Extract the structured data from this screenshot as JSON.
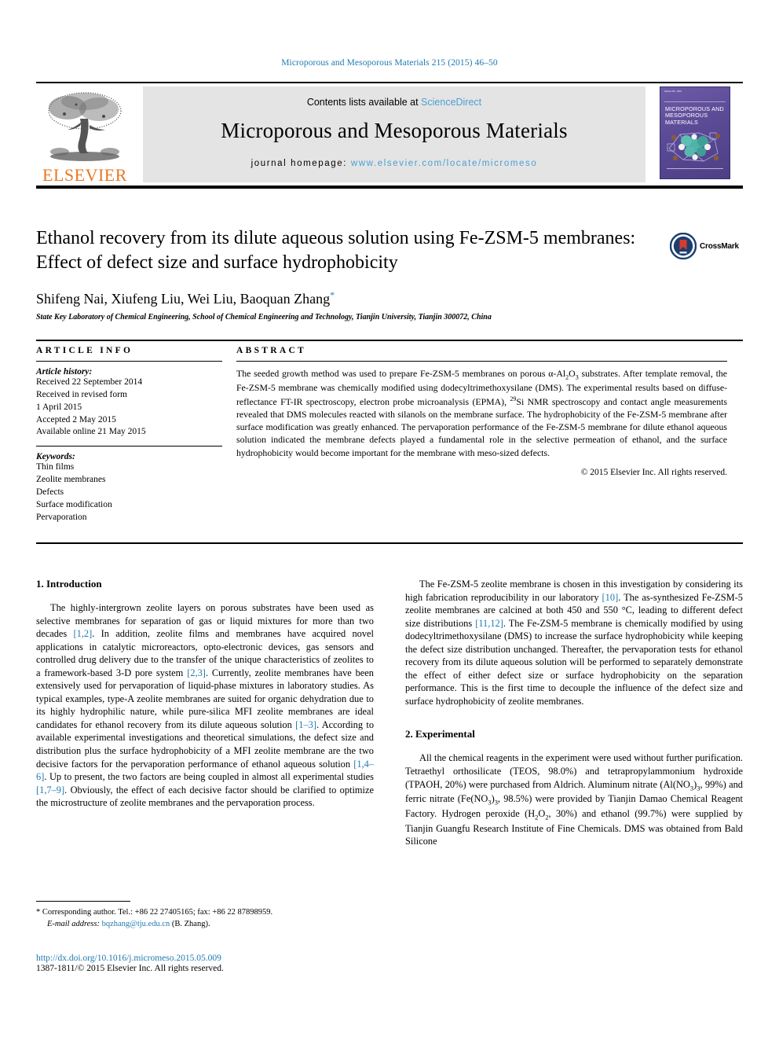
{
  "running_head": "Microporous and Mesoporous Materials 215 (2015) 46–50",
  "masthead": {
    "contents_prefix": "Contents lists available at ",
    "sciencedirect": "ScienceDirect",
    "journal_title": "Microporous and Mesoporous Materials",
    "homepage_prefix": "journal homepage: ",
    "homepage_url": "www.elsevier.com/locate/micromeso",
    "publisher_name": "ELSEVIER",
    "cover_title": "MICROPOROUS AND MESOPOROUS MATERIALS",
    "cover_topbar": "Volume 215 · 2015",
    "accent_blue": "#4a9fd4",
    "elsevier_orange": "#e87722",
    "cover_purple": "#5b4a96"
  },
  "article": {
    "title": "Ethanol recovery from its dilute aqueous solution using Fe-ZSM-5 membranes: Effect of defect size and surface hydrophobicity",
    "authors": "Shifeng Nai, Xiufeng Liu, Wei Liu, Baoquan Zhang",
    "corresponding_marker": "*",
    "affiliation": "State Key Laboratory of Chemical Engineering, School of Chemical Engineering and Technology, Tianjin University, Tianjin 300072, China",
    "crossmark_label": "CrossMark"
  },
  "article_info": {
    "heading": "ARTICLE INFO",
    "history_label": "Article history:",
    "history_lines": [
      "Received 22 September 2014",
      "Received in revised form",
      "1 April 2015",
      "Accepted 2 May 2015",
      "Available online 21 May 2015"
    ],
    "keywords_label": "Keywords:",
    "keywords": [
      "Thin films",
      "Zeolite membranes",
      "Defects",
      "Surface modification",
      "Pervaporation"
    ]
  },
  "abstract": {
    "heading": "ABSTRACT",
    "paragraph_part1": "The seeded growth method was used to prepare Fe-ZSM-5 membranes on porous α-Al",
    "paragraph_part2": "O",
    "paragraph_part3": " substrates. After template removal, the Fe-ZSM-5 membrane was chemically modified using dodecyltrimethoxysilane (DMS). The experimental results based on diffuse-reflectance FT-IR spectroscopy, electron probe microanalysis (EPMA), ",
    "si_superscript": "29",
    "paragraph_part4": "Si NMR spectroscopy and contact angle measurements revealed that DMS molecules reacted with silanols on the membrane surface. The hydrophobicity of the Fe-ZSM-5 membrane after surface modification was greatly enhanced. The pervaporation performance of the Fe-ZSM-5 membrane for dilute ethanol aqueous solution indicated the membrane defects played a fundamental role in the selective permeation of ethanol, and the surface hydrophobicity would become important for the membrane with meso-sized defects.",
    "copyright": "© 2015 Elsevier Inc. All rights reserved."
  },
  "sections": {
    "introduction_heading": "1. Introduction",
    "experimental_heading": "2. Experimental",
    "intro_p1_a": "The highly-intergrown zeolite layers on porous substrates have been used as selective membranes for separation of gas or liquid mixtures for more than two decades ",
    "intro_p1_ref1": "[1,2]",
    "intro_p1_b": ". In addition, zeolite films and membranes have acquired novel applications in catalytic microreactors, opto-electronic devices, gas sensors and controlled drug delivery due to the transfer of the unique characteristics of zeolites to a framework-based 3-D pore system ",
    "intro_p1_ref2": "[2,3]",
    "intro_p1_c": ". Currently, zeolite membranes have been extensively used for pervaporation of liquid-phase mixtures in laboratory studies. As typical examples, type-A zeolite membranes are suited for organic dehydration due to its highly hydrophilic nature, while pure-silica MFI zeolite membranes are ideal candidates for ethanol recovery from its dilute aqueous solution ",
    "intro_p1_ref3": "[1–3]",
    "intro_p1_d": ". According to available experimental investigations and theoretical simulations, the defect size and distribution plus the surface hydrophobicity of a MFI zeolite membrane are the two decisive factors for the pervaporation performance of ethanol aqueous solution ",
    "intro_p1_ref4": "[1,4–6]",
    "intro_p1_e": ". Up to present, the two factors are being coupled in almost all experimental studies ",
    "intro_p1_ref5": "[1,7–9]",
    "intro_p1_f": ". Obviously, the effect of each decisive factor should be clarified to optimize the microstructure of zeolite membranes and the pervaporation process.",
    "intro_p2_a": "The Fe-ZSM-5 zeolite membrane is chosen in this investigation by considering its high fabrication reproducibility in our laboratory ",
    "intro_p2_ref1": "[10]",
    "intro_p2_b": ". The as-synthesized Fe-ZSM-5 zeolite membranes are calcined at both 450 and 550 °C, leading to different defect size distributions ",
    "intro_p2_ref2": "[11,12]",
    "intro_p2_c": ". The Fe-ZSM-5 membrane is chemically modified by using dodecyltrimethoxysilane (DMS) to increase the surface hydrophobicity while keeping the defect size distribution unchanged. Thereafter, the pervaporation tests for ethanol recovery from its dilute aqueous solution will be performed to separately demonstrate the effect of either defect size or surface hydrophobicity on the separation performance. This is the first time to decouple the influence of the defect size and surface hydrophobicity of zeolite membranes.",
    "exp_p1_a": "All the chemical reagents in the experiment were used without further purification. Tetraethyl orthosilicate (TEOS, 98.0%) and tetrapropylammonium hydroxide (TPAOH, 20%) were purchased from Aldrich. Aluminum nitrate (Al(NO",
    "exp_sub1": "3",
    "exp_p1_b": ")",
    "exp_sub2": "3",
    "exp_p1_c": ", 99%) and ferric nitrate (Fe(NO",
    "exp_sub3": "3",
    "exp_p1_d": ")",
    "exp_sub4": "3",
    "exp_p1_e": ", 98.5%) were provided by Tianjin Damao Chemical Reagent Factory. Hydrogen peroxide (H",
    "exp_sub5": "2",
    "exp_p1_f": "O",
    "exp_sub6": "2",
    "exp_p1_g": ", 30%) and ethanol (99.7%) were supplied by Tianjin Guangfu Research Institute of Fine Chemicals. DMS was obtained from Bald Silicone"
  },
  "footer": {
    "corresponding_marker": "*",
    "corresponding_text": "Corresponding author. Tel.: +86 22 27405165; fax: +86 22 87898959.",
    "email_label": "E-mail address:",
    "email": "bqzhang@tju.edu.cn",
    "email_suffix": "(B. Zhang).",
    "doi": "http://dx.doi.org/10.1016/j.micromeso.2015.05.009",
    "issn_line": "1387-1811/© 2015 Elsevier Inc. All rights reserved."
  }
}
